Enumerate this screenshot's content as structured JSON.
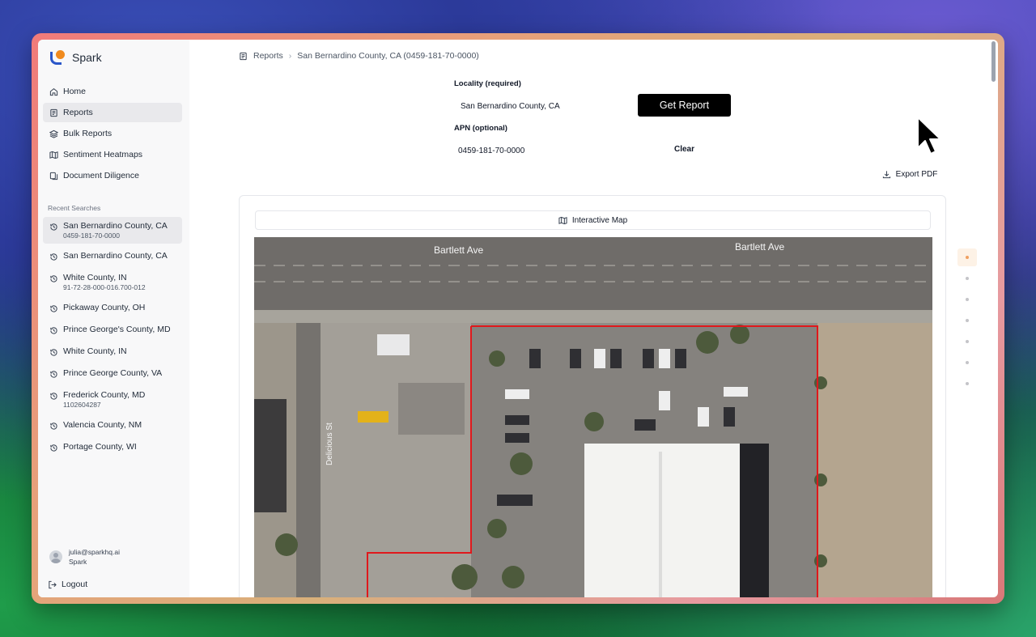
{
  "app": {
    "name": "Spark"
  },
  "nav": {
    "items": [
      {
        "label": "Home",
        "icon": "home-icon"
      },
      {
        "label": "Reports",
        "icon": "reports-icon"
      },
      {
        "label": "Bulk Reports",
        "icon": "layers-icon"
      },
      {
        "label": "Sentiment Heatmaps",
        "icon": "map-icon"
      },
      {
        "label": "Document Diligence",
        "icon": "documents-icon"
      }
    ],
    "active_index": 1
  },
  "recent": {
    "title": "Recent Searches",
    "items": [
      {
        "label": "San Bernardino County, CA",
        "sub": "0459-181-70-0000"
      },
      {
        "label": "San Bernardino County, CA",
        "sub": ""
      },
      {
        "label": "White County, IN",
        "sub": "91-72-28-000-016.700-012"
      },
      {
        "label": "Pickaway County, OH",
        "sub": ""
      },
      {
        "label": "Prince George's County, MD",
        "sub": ""
      },
      {
        "label": "White County, IN",
        "sub": ""
      },
      {
        "label": "Prince George County, VA",
        "sub": ""
      },
      {
        "label": "Frederick County, MD",
        "sub": "1102604287"
      },
      {
        "label": "Valencia County, NM",
        "sub": ""
      },
      {
        "label": "Portage County, WI",
        "sub": ""
      }
    ],
    "active_index": 0
  },
  "user": {
    "email": "julia@sparkhq.ai",
    "org": "Spark",
    "logout": "Logout"
  },
  "breadcrumb": {
    "root": "Reports",
    "current": "San Bernardino County, CA (0459-181-70-0000)"
  },
  "form": {
    "locality_label": "Locality (required)",
    "locality_value": "San Bernardino County, CA",
    "apn_label": "APN (optional)",
    "apn_value": "0459-181-70-0000",
    "get_report": "Get Report",
    "clear": "Clear"
  },
  "export_pdf": "Export PDF",
  "map": {
    "tab_label": "Interactive Map",
    "streets": [
      "Bartlett Ave",
      "Bartlett Ave",
      "Delicious St"
    ],
    "parcel_color": "#e0181c"
  },
  "pager": {
    "count": 7,
    "active_index": 0
  },
  "colors": {
    "accent": "#f08a1e",
    "brand": "#2a56c9",
    "button": "#000000"
  }
}
